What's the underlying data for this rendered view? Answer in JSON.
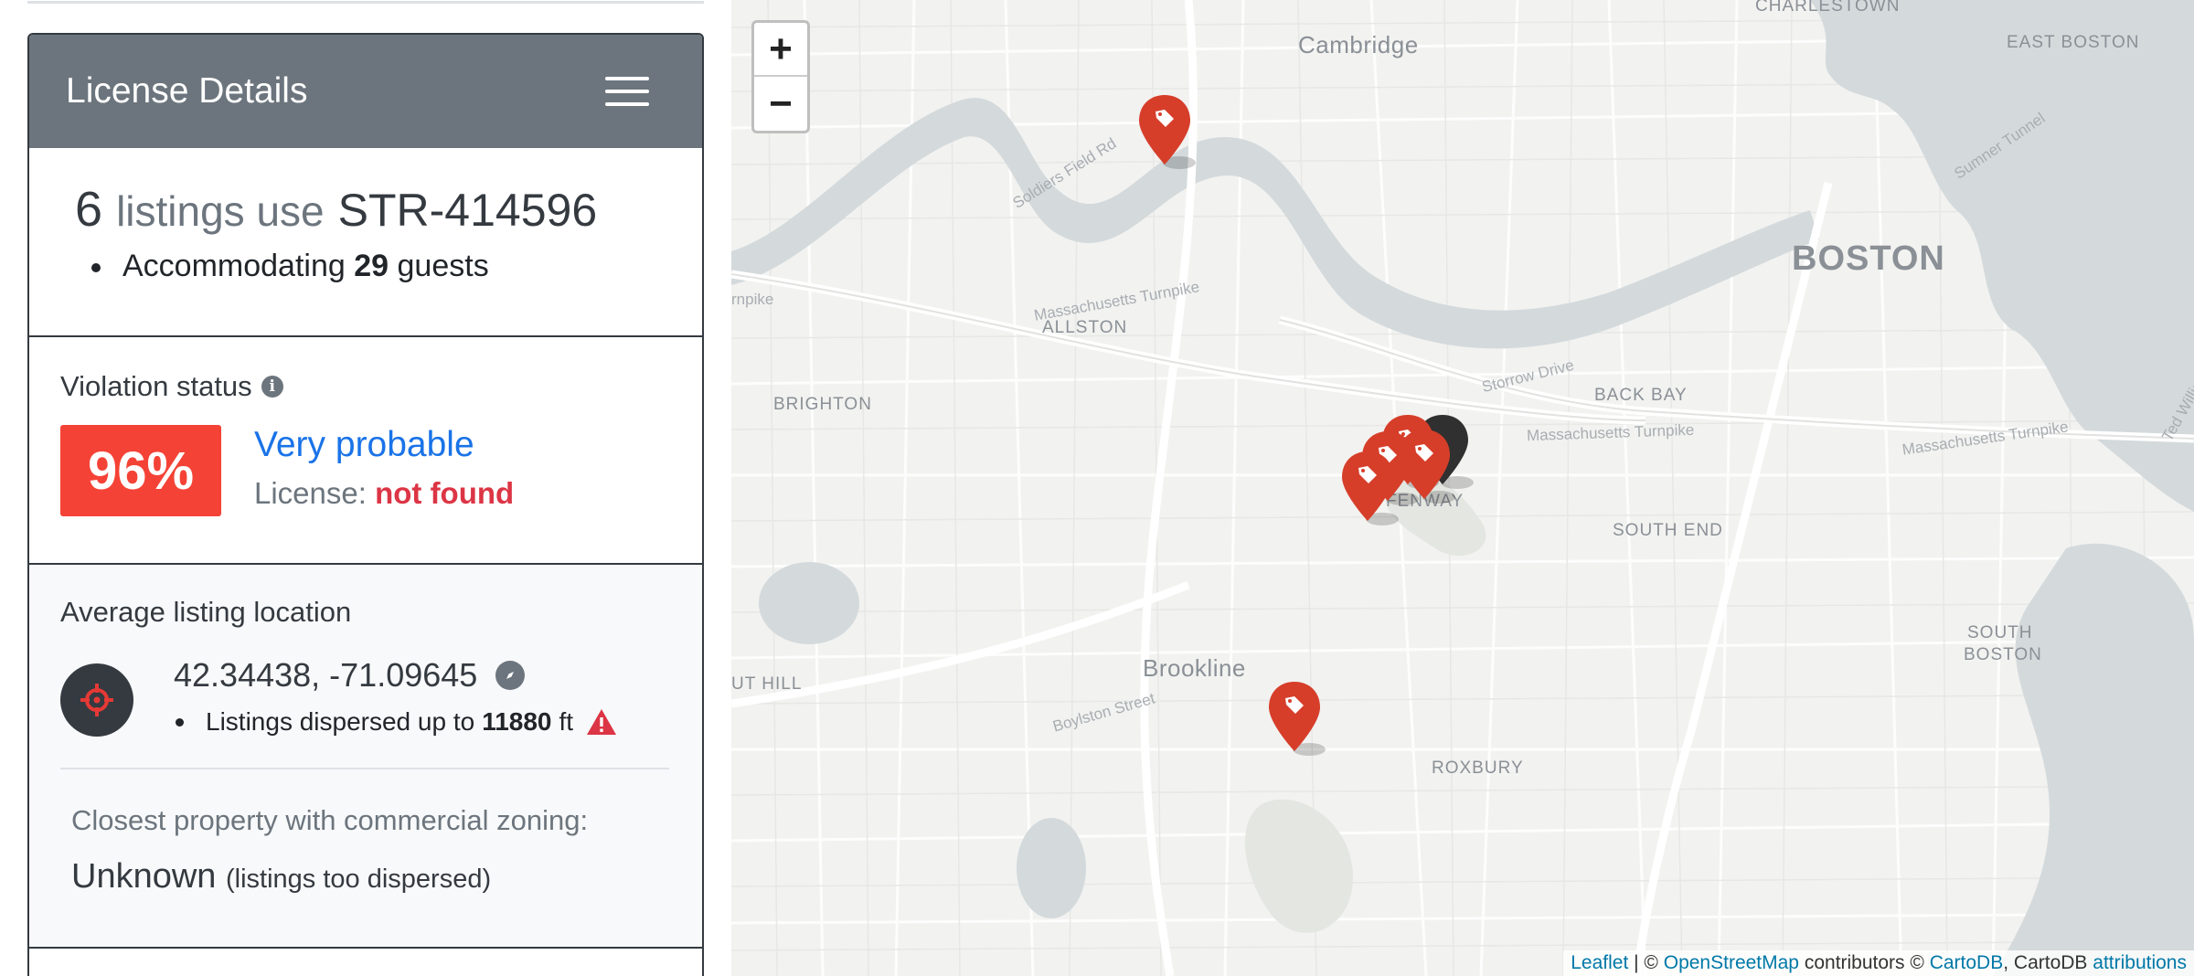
{
  "sidebar": {
    "card_title": "License Details",
    "summary": {
      "count": "6",
      "middle_text": "listings use",
      "license_id": "STR-414596",
      "guests_prefix": "Accommodating",
      "guests": "29",
      "guests_suffix": "guests"
    },
    "violation": {
      "label": "Violation status",
      "percent": "96%",
      "probability": "Very probable",
      "license_label": "License:",
      "license_status": "not found"
    },
    "location": {
      "label": "Average listing location",
      "coords": "42.34438, -71.09645",
      "disperse_prefix": "Listings dispersed up to",
      "disperse_value": "11880",
      "disperse_unit": "ft",
      "zoning_label": "Closest property with commercial zoning:",
      "zoning_value": "Unknown",
      "zoning_note": "(listings too dispersed)"
    }
  },
  "map": {
    "zoom_in": "+",
    "zoom_out": "−",
    "places": {
      "charlestown": "CHARLESTOWN",
      "east_boston": "EAST BOSTON",
      "cambridge": "Cambridge",
      "boston": "BOSTON",
      "allston": "ALLSTON",
      "brighton": "BRIGHTON",
      "back_bay": "BACK BAY",
      "fenway": "FENWAY",
      "south_end": "SOUTH END",
      "south_boston_1": "SOUTH",
      "south_boston_2": "BOSTON",
      "brookline": "Brookline",
      "roxbury": "ROXBURY",
      "hill": "UT HILL"
    },
    "roads": {
      "soldiers_field": "Soldiers Field Rd",
      "mass_turnpike_1": "Massachusetts Turnpike",
      "mass_turnpike_2": "Massachusetts Turnpike",
      "mass_turnpike_3": "Massachusetts Turnpike",
      "storrow": "Storrow Drive",
      "boylston": "Boylston Street",
      "sumner": "Sumner Tunnel",
      "ted_williams": "Ted Williams Tu",
      "pike": "rnpike"
    },
    "attribution": {
      "leaflet": "Leaflet",
      "sep": " | © ",
      "osm": "OpenStreetMap",
      "contributors": " contributors © ",
      "cartodb": "CartoDB",
      "mid": ", CartoDB ",
      "attributions": "attributions"
    },
    "marker_color": "#d63e2a",
    "marker_dark_color": "#303030"
  },
  "colors": {
    "header_bg": "#6c757d",
    "badge_red": "#f44336",
    "link_blue": "#1a73e8",
    "danger": "#dc3545",
    "water": "#d4dadc"
  }
}
